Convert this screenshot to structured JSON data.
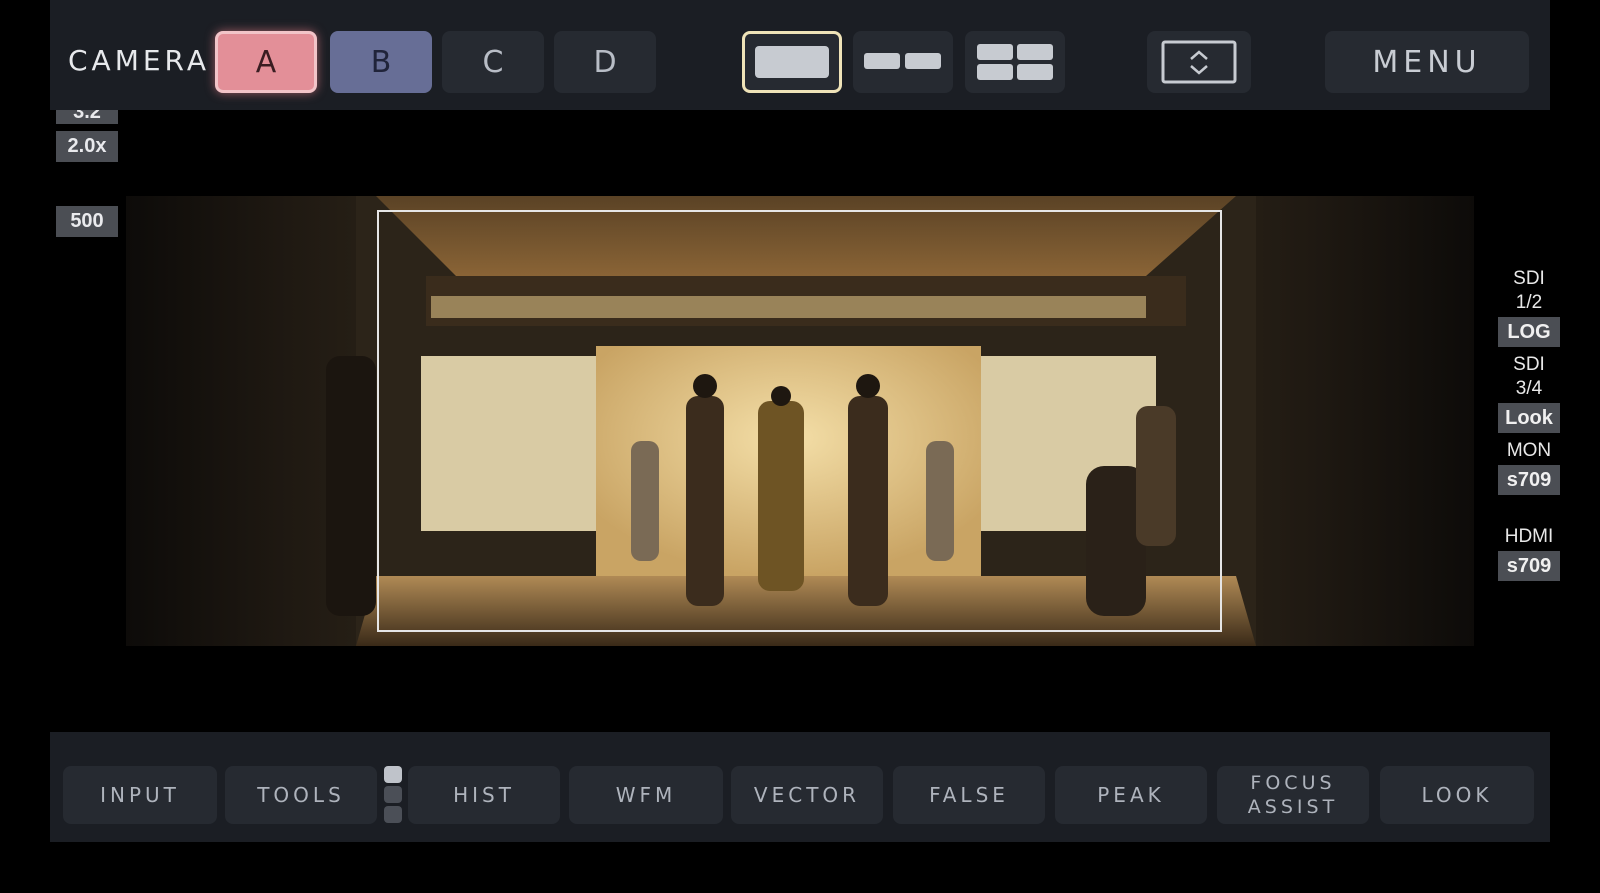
{
  "topbar": {
    "camera_label": "CAMERA",
    "cameras": [
      "A",
      "B",
      "C",
      "D"
    ],
    "selected_camera": "A",
    "menu_label": "MENU"
  },
  "left_indicators": {
    "top_cut": "3.2",
    "zoom": "2.0x",
    "value": "500"
  },
  "outputs": [
    {
      "label": "SDI 1/2",
      "value": "LOG"
    },
    {
      "label": "SDI 3/4",
      "value": "Look"
    },
    {
      "label": "MON",
      "value": "s709"
    },
    {
      "label": "HDMI",
      "value": "s709"
    }
  ],
  "bottom_tools": {
    "input": "INPUT",
    "tools": "TOOLS",
    "hist": "HIST",
    "wfm": "WFM",
    "vector": "VECTOR",
    "false": "FALSE",
    "peak": "PEAK",
    "focus_assist": "FOCUS\nASSIST",
    "look": "LOOK"
  },
  "colors": {
    "camera_a": "#e38f98",
    "camera_b": "#676e96",
    "bar_bg": "#1b1e24",
    "button_bg": "#262a31"
  }
}
